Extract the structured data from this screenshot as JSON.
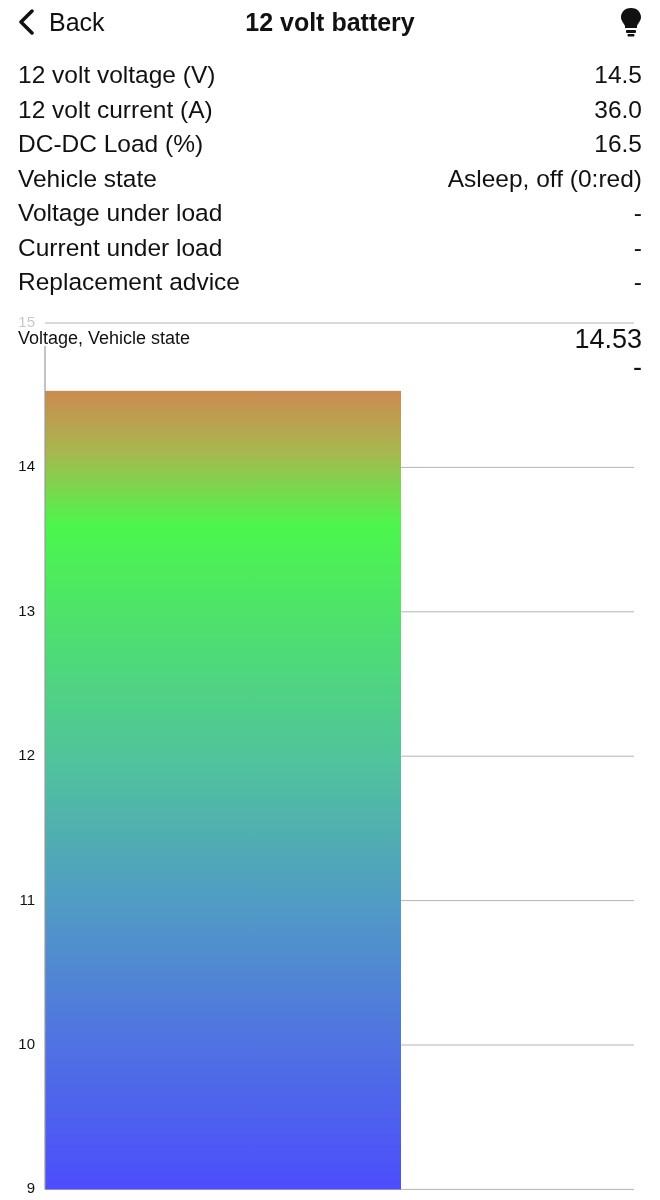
{
  "nav": {
    "back": "Back",
    "title": "12 volt battery"
  },
  "readings": [
    {
      "label": "12 volt voltage (V)",
      "value": "14.5"
    },
    {
      "label": "12 volt current (A)",
      "value": "36.0"
    },
    {
      "label": "DC-DC Load (%)",
      "value": "16.5"
    },
    {
      "label": "Vehicle state",
      "value": "Asleep, off (0:red)"
    },
    {
      "label": "Voltage under load",
      "value": "-"
    },
    {
      "label": "Current under load",
      "value": "-"
    },
    {
      "label": "Replacement advice",
      "value": "-"
    }
  ],
  "chart": {
    "readouts": [
      "14.53",
      "-"
    ],
    "chart_data": {
      "type": "bar",
      "title": "Voltage, Vehicle state",
      "values": [
        14.53
      ],
      "ylim": [
        9,
        15
      ],
      "yticks": [
        9,
        10,
        11,
        12,
        13,
        14,
        15
      ],
      "grid": true
    }
  }
}
